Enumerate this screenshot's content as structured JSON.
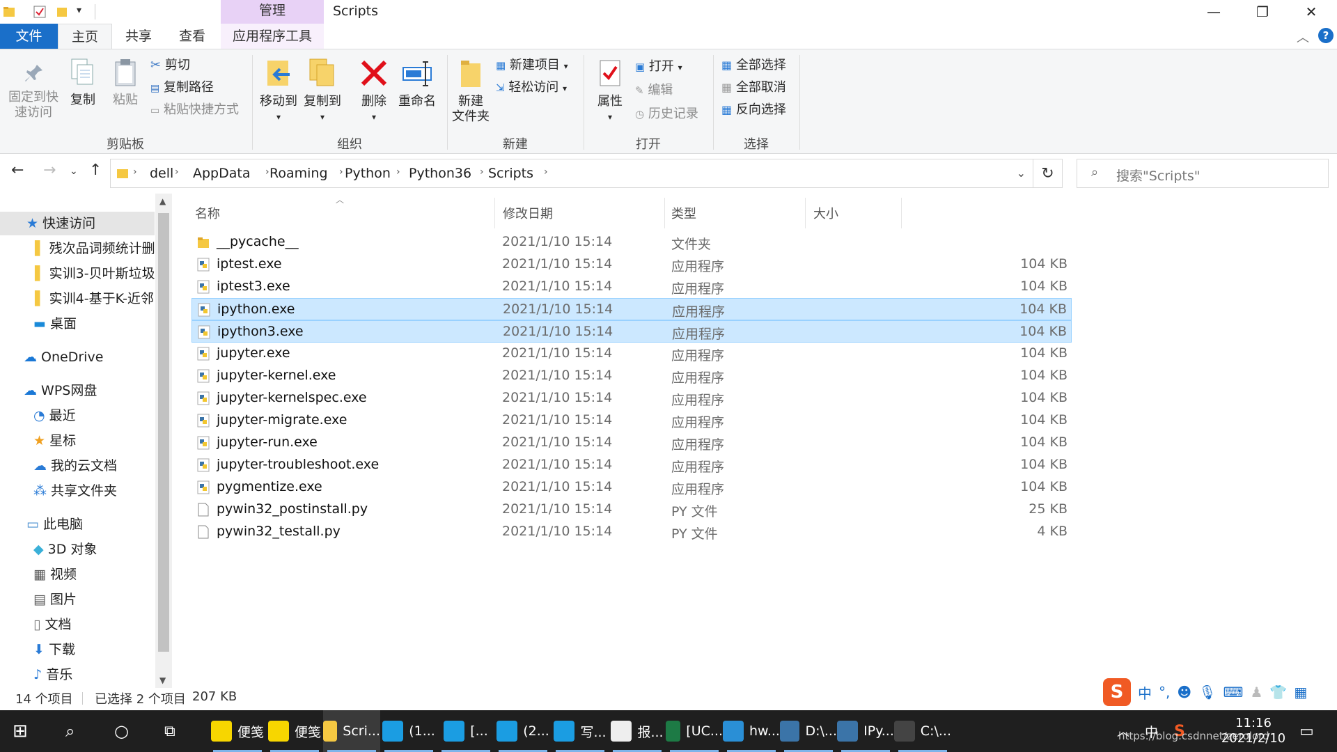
{
  "window": {
    "title": "Scripts",
    "context_tab": "管理",
    "minimize": "—",
    "maximize": "❐",
    "close": "✕"
  },
  "tabs": {
    "file": "文件",
    "home": "主页",
    "share": "共享",
    "view": "查看",
    "app_tools": "应用程序工具"
  },
  "ribbon": {
    "pin_line1": "固定到快",
    "pin_line2": "速访问",
    "copy": "复制",
    "paste": "粘贴",
    "cut": "剪切",
    "copy_path": "复制路径",
    "paste_shortcut": "粘贴快捷方式",
    "group_clipboard": "剪贴板",
    "move_to": "移动到",
    "copy_to": "复制到",
    "delete": "删除",
    "rename": "重命名",
    "group_organize": "组织",
    "new_folder_line1": "新建",
    "new_folder_line2": "文件夹",
    "new_item": "新建项目",
    "easy_access": "轻松访问",
    "group_new": "新建",
    "properties": "属性",
    "open": "打开",
    "edit": "编辑",
    "history": "历史记录",
    "group_open": "打开",
    "select_all": "全部选择",
    "select_none": "全部取消",
    "invert": "反向选择",
    "group_select": "选择"
  },
  "address": {
    "crumbs": [
      "dell",
      "AppData",
      "Roaming",
      "Python",
      "Python36",
      "Scripts"
    ],
    "search_placeholder": "搜索\"Scripts\""
  },
  "nav": {
    "quick_access": "快速访问",
    "pinned": [
      "残次品词频统计删",
      "实训3-贝叶斯垃圾",
      "实训4-基于K-近邻"
    ],
    "desktop": "桌面",
    "onedrive": "OneDrive",
    "wps": "WPS网盘",
    "recent": "最近",
    "star": "星标",
    "cloud_docs": "我的云文档",
    "shared": "共享文件夹",
    "this_pc": "此电脑",
    "objects3d": "3D 对象",
    "videos": "视频",
    "pictures": "图片",
    "documents": "文档",
    "downloads": "下载",
    "music": "音乐"
  },
  "columns": {
    "name": "名称",
    "date": "修改日期",
    "type": "类型",
    "size": "大小"
  },
  "files": [
    {
      "name": "__pycache__",
      "date": "2021/1/10 15:14",
      "type": "文件夹",
      "size": "",
      "kind": "folder",
      "selected": false
    },
    {
      "name": "iptest.exe",
      "date": "2021/1/10 15:14",
      "type": "应用程序",
      "size": "104 KB",
      "kind": "exe",
      "selected": false
    },
    {
      "name": "iptest3.exe",
      "date": "2021/1/10 15:14",
      "type": "应用程序",
      "size": "104 KB",
      "kind": "exe",
      "selected": false
    },
    {
      "name": "ipython.exe",
      "date": "2021/1/10 15:14",
      "type": "应用程序",
      "size": "104 KB",
      "kind": "exe",
      "selected": true
    },
    {
      "name": "ipython3.exe",
      "date": "2021/1/10 15:14",
      "type": "应用程序",
      "size": "104 KB",
      "kind": "exe",
      "selected": true
    },
    {
      "name": "jupyter.exe",
      "date": "2021/1/10 15:14",
      "type": "应用程序",
      "size": "104 KB",
      "kind": "exe",
      "selected": false
    },
    {
      "name": "jupyter-kernel.exe",
      "date": "2021/1/10 15:14",
      "type": "应用程序",
      "size": "104 KB",
      "kind": "exe",
      "selected": false
    },
    {
      "name": "jupyter-kernelspec.exe",
      "date": "2021/1/10 15:14",
      "type": "应用程序",
      "size": "104 KB",
      "kind": "exe",
      "selected": false
    },
    {
      "name": "jupyter-migrate.exe",
      "date": "2021/1/10 15:14",
      "type": "应用程序",
      "size": "104 KB",
      "kind": "exe",
      "selected": false
    },
    {
      "name": "jupyter-run.exe",
      "date": "2021/1/10 15:14",
      "type": "应用程序",
      "size": "104 KB",
      "kind": "exe",
      "selected": false
    },
    {
      "name": "jupyter-troubleshoot.exe",
      "date": "2021/1/10 15:14",
      "type": "应用程序",
      "size": "104 KB",
      "kind": "exe",
      "selected": false
    },
    {
      "name": "pygmentize.exe",
      "date": "2021/1/10 15:14",
      "type": "应用程序",
      "size": "104 KB",
      "kind": "exe",
      "selected": false
    },
    {
      "name": "pywin32_postinstall.py",
      "date": "2021/1/10 15:14",
      "type": "PY 文件",
      "size": "25 KB",
      "kind": "py",
      "selected": false
    },
    {
      "name": "pywin32_testall.py",
      "date": "2021/1/10 15:14",
      "type": "PY 文件",
      "size": "4 KB",
      "kind": "py",
      "selected": false
    }
  ],
  "status": {
    "count": "14 个项目",
    "selected": "已选择 2 个项目",
    "size": "207 KB"
  },
  "taskbar": {
    "items": [
      {
        "label": "便笺",
        "icon": "sticky-notes-icon",
        "color": "#f7d600"
      },
      {
        "label": "便笺",
        "icon": "sticky-notes-icon",
        "color": "#f7d600"
      },
      {
        "label": "Scri...",
        "icon": "folder-icon",
        "color": "#f5c842"
      },
      {
        "label": "(1...",
        "icon": "edge-icon",
        "color": "#1b9de2"
      },
      {
        "label": "[...",
        "icon": "edge-icon",
        "color": "#1b9de2"
      },
      {
        "label": "(2...",
        "icon": "edge-icon",
        "color": "#1b9de2"
      },
      {
        "label": "写...",
        "icon": "edge-icon",
        "color": "#1b9de2"
      },
      {
        "label": "报...",
        "icon": "typora-icon",
        "color": "#eeeeee"
      },
      {
        "label": "[UC...",
        "icon": "excel-icon",
        "color": "#1d7a45"
      },
      {
        "label": "hw...",
        "icon": "vscode-icon",
        "color": "#2a8fd6"
      },
      {
        "label": "D:\\...",
        "icon": "python-icon",
        "color": "#3b74a8"
      },
      {
        "label": "IPy...",
        "icon": "python-icon",
        "color": "#3b74a8"
      },
      {
        "label": "C:\\...",
        "icon": "cmd-icon",
        "color": "#444444"
      }
    ],
    "ime": "中",
    "time": "11:16",
    "date": "2021/2/10",
    "watermark": "https://blog.csdnnet/zerolord"
  },
  "colors": {
    "accent": "#1a6fc9",
    "selection": "#cce8ff",
    "context": "#e8d2f6"
  }
}
